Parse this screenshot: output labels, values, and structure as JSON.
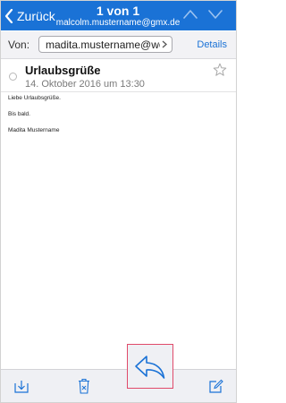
{
  "navbar": {
    "back_label": "Zurück",
    "counter": "1 von 1",
    "account": "malcolm.mustername@gmx.de"
  },
  "from_row": {
    "label": "Von:",
    "sender": "madita.mustername@we...",
    "details_label": "Details"
  },
  "message": {
    "subject": "Urlaubsgrüße",
    "date": "14. Oktober 2016 um 13:30",
    "body": [
      "Liebe Urlaubsgrüße.",
      "Bis bald.",
      "Madita Mustername"
    ]
  },
  "colors": {
    "accent": "#1a72d6",
    "highlight": "#e04a6a",
    "toolbar_bg": "#eff0f4"
  },
  "icons": {
    "back": "chevron-left-icon",
    "prev": "chevron-up-icon",
    "next": "chevron-down-icon",
    "star": "star-icon",
    "archive": "archive-icon",
    "trash": "trash-icon",
    "reply": "reply-icon",
    "compose": "compose-icon"
  }
}
